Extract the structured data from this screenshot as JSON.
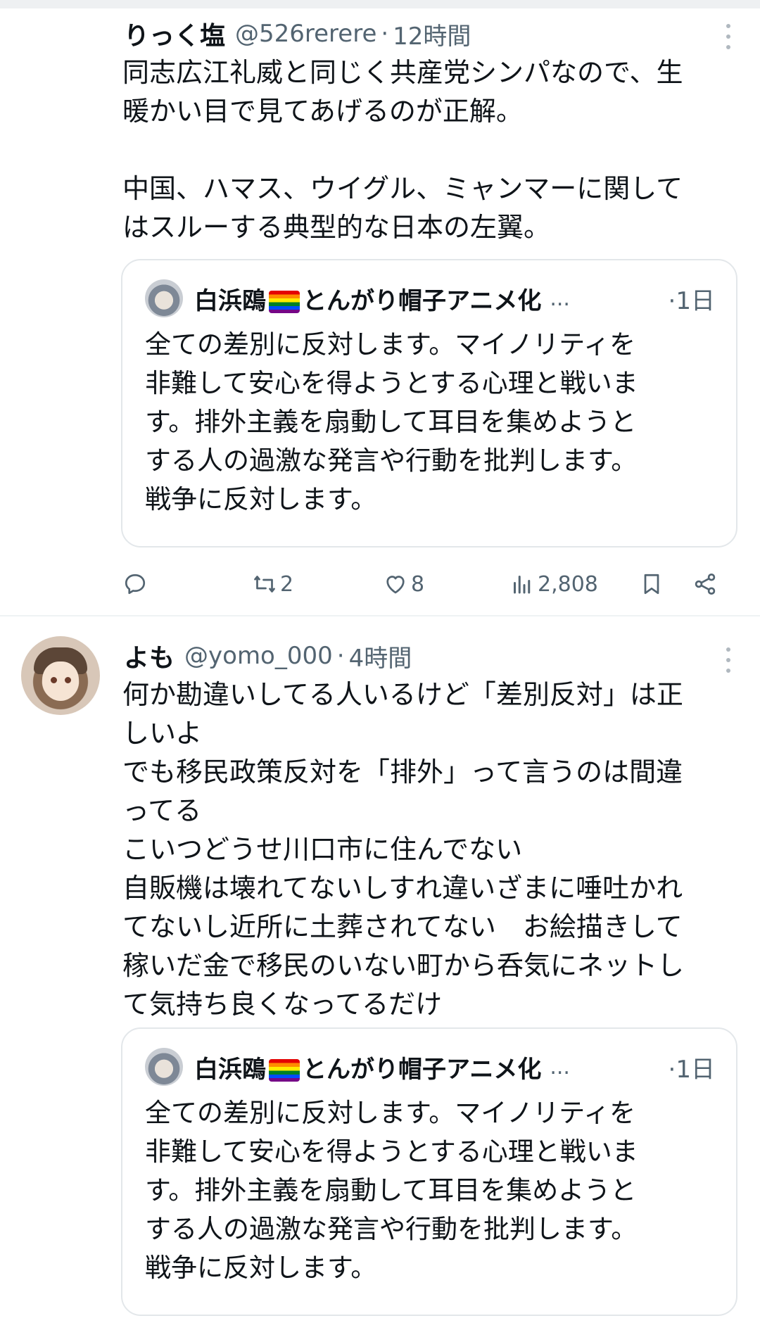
{
  "tweets": [
    {
      "author_name": "りっく塩",
      "handle": "@526rerere",
      "time": "12時間",
      "text": "同志広江礼威と同じく共産党シンパなので、生\n暖かい目で見てあげるのが正解。\n\n中国、ハマス、ウイグル、ミャンマーに関して\nはスルーする典型的な日本の左翼。",
      "quote": {
        "author_name_a": "白浜鴎",
        "author_name_b": "とんがり帽子アニメ化",
        "ellipsis": "...",
        "time": "1日",
        "text": "全ての差別に反対します。マイノリティを\n非難して安心を得ようとする心理と戦いま\nす。排外主義を扇動して耳目を集めようと\nする人の過激な発言や行動を批判します。\n戦争に反対します。"
      },
      "actions": {
        "reposts": "2",
        "likes": "8",
        "views": "2,808"
      }
    },
    {
      "author_name": "よも",
      "handle": "@yomo_000",
      "time": "4時間",
      "text": "何か勘違いしてる人いるけど「差別反対」は正\nしいよ\nでも移民政策反対を「排外」って言うのは間違\nってる\nこいつどうせ川口市に住んでない\n自販機は壊れてないしすれ違いざまに唾吐かれ\nてないし近所に土葬されてない　お絵描きして\n稼いだ金で移民のいない町から呑気にネットし\nて気持ち良くなってるだけ",
      "quote": {
        "author_name_a": "白浜鴎",
        "author_name_b": "とんがり帽子アニメ化",
        "ellipsis": "...",
        "time": "1日",
        "text": "全ての差別に反対します。マイノリティを\n非難して安心を得ようとする心理と戦いま\nす。排外主義を扇動して耳目を集めようと\nする人の過激な発言や行動を批判します。\n戦争に反対します。"
      }
    }
  ],
  "separator": "·",
  "icons": [
    "more-icon",
    "reply-icon",
    "repost-icon",
    "like-icon",
    "views-icon",
    "bookmark-icon",
    "share-icon"
  ],
  "colors": {
    "secondary_text": "#536471",
    "primary_text": "#0f1419",
    "border": "#e3e7ea"
  }
}
